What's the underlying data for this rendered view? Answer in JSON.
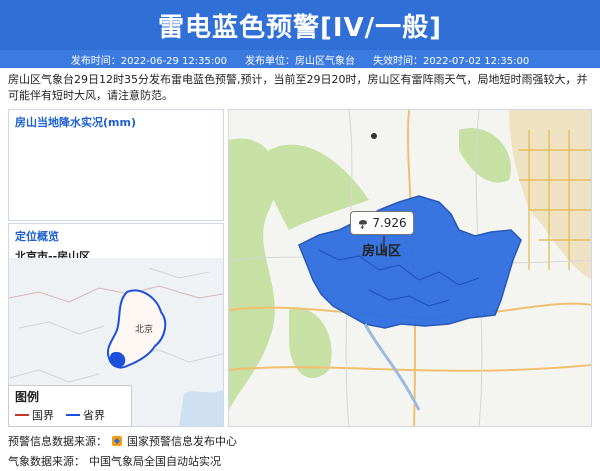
{
  "header": {
    "title": "雷电蓝色预警[IV/一般]"
  },
  "meta": {
    "issue_time": "发布时间：2022-06-29 12:35:00",
    "issuer": "发布单位：房山区气象台",
    "expire_time": "失效时间：2022-07-02 12:35:00"
  },
  "description": "房山区气象台29日12时35分发布雷电蓝色预警,预计，当前至29日20时，房山区有雷阵雨天气，局地短时雨强较大，并可能伴有短时大风，请注意防范。",
  "rain_panel": {
    "title": "房山当地降水实况(mm)"
  },
  "location_panel": {
    "title": "定位概览",
    "subtitle": "北京市--房山区",
    "city_label": "北京"
  },
  "legend": {
    "title": "图例",
    "national": "国界",
    "provincial": "省界",
    "national_color": "#c0392b",
    "provincial_color": "#1d4fd8"
  },
  "map": {
    "value": "7.926",
    "region_label": "房山区",
    "weather_icon": "thunderstorm-icon",
    "region_color": "#2f6fe0"
  },
  "footer": {
    "source_label": "预警信息数据来源：",
    "source_value": "国家预警信息发布中心",
    "weather_label": "气象数据来源：",
    "weather_value": "中国气象局全国自动站实况"
  }
}
